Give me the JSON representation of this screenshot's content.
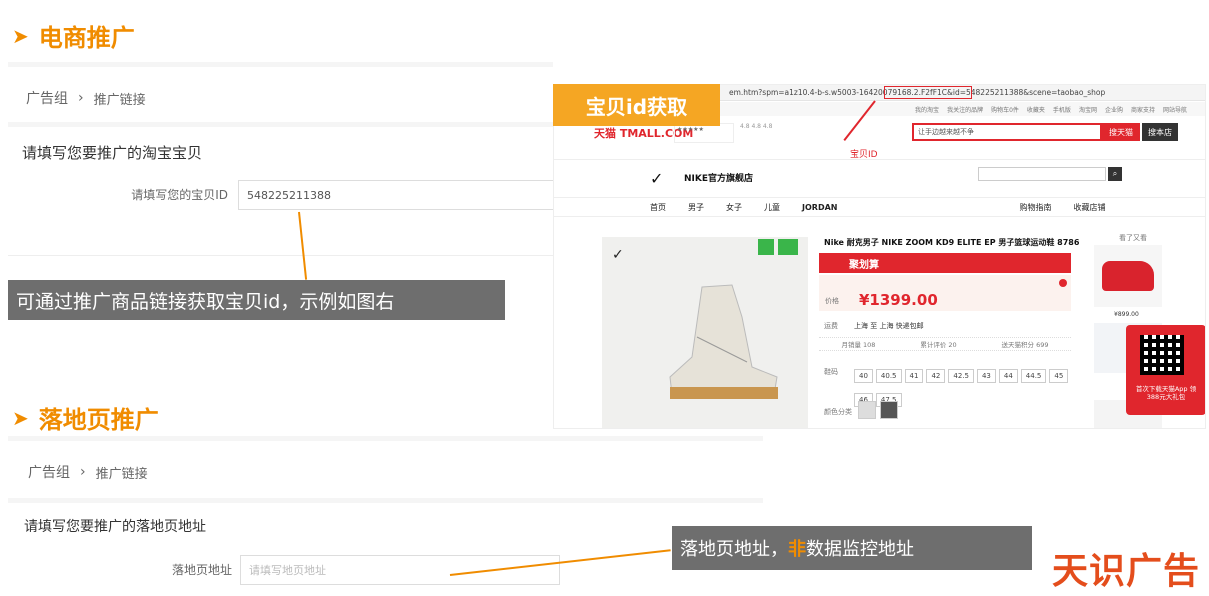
{
  "ecommerce": {
    "title": "电商推广",
    "breadcrumb": {
      "group": "广告组",
      "link": "推广链接"
    },
    "section_head": "请填写您要推广的淘宝宝贝",
    "field_label": "请填写您的宝贝ID",
    "field_value": "548225211388",
    "note": "可通过推广商品链接获取宝贝id，示例如图右"
  },
  "screenshot": {
    "badge": "宝贝id获取",
    "url_text": "em.htm?spm=a1z10.4-b-s.w5003-16420079168.2.F2fF1C&id=548225211388&scene=taobao_shop",
    "id_annotation": "宝贝ID",
    "tmall_logo": "天猫 TMALL.COM",
    "search_placeholder": "让手边越来越不争",
    "search_button": "搜天猫",
    "search_store_button": "搜本店",
    "top_links": [
      "我的淘宝",
      "我关注的品牌",
      "购物车0件",
      "收藏夹",
      "手机版",
      "淘宝网",
      "企业购",
      "商家支持",
      "网站导航"
    ],
    "store_name": "NIKE官方旗舰店",
    "nav": [
      "首页",
      "男子",
      "女子",
      "儿童",
      "JORDAN"
    ],
    "nav_right": [
      "购物指南",
      "收藏店铺"
    ],
    "product_title": "Nike 耐克男子 NIKE ZOOM KD9 ELITE EP 男子篮球运动鞋 878639",
    "promo": "聚划算",
    "price_label": "价格",
    "price": "¥1399.00",
    "delivery_label": "运费",
    "delivery": "上海 至 上海 快递包邮",
    "stats": [
      "月销量 108",
      "累计评价 20",
      "送天猫积分 699"
    ],
    "size_label": "鞋码",
    "sizes": [
      "40",
      "40.5",
      "41",
      "42",
      "42.5",
      "43",
      "44",
      "44.5",
      "45",
      "46",
      "47.5"
    ],
    "color_label": "颜色分类",
    "side_price": "¥899.00",
    "side_title": "看了又看",
    "app_promo": "首次下载天猫App 领388元大礼包"
  },
  "landing": {
    "title": "落地页推广",
    "breadcrumb": {
      "group": "广告组",
      "link": "推广链接"
    },
    "section_head": "请填写您要推广的落地页地址",
    "field_label": "落地页地址",
    "field_placeholder": "请填写地页地址",
    "note_part1": "落地页地址，",
    "note_highlight": "非",
    "note_part2": "数据监控地址"
  },
  "brand": "天识广告",
  "colors": {
    "accent": "#f08c00",
    "tmall_red": "#e0262d",
    "note_gray": "#6e6e6e"
  }
}
